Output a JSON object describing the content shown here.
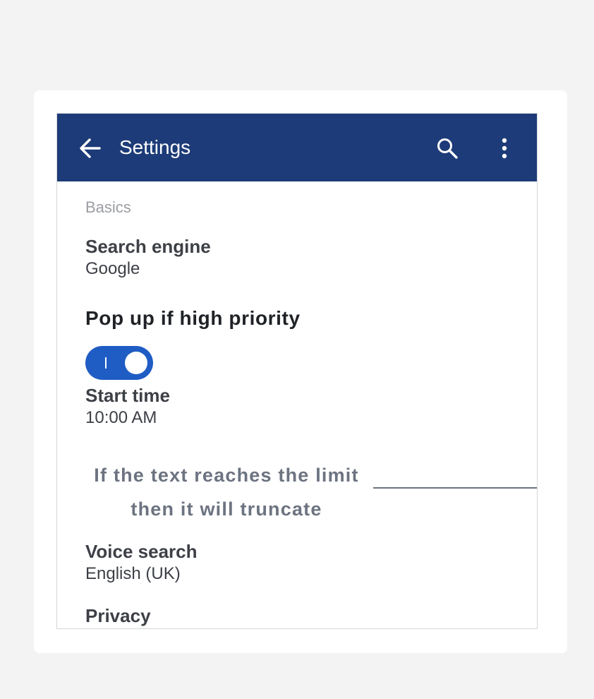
{
  "appbar": {
    "title": "Settings",
    "back_icon": "arrow-back-icon",
    "search_icon": "search-icon",
    "more_icon": "more-vert-icon",
    "color": "#1d3b78"
  },
  "section": {
    "header": "Basics"
  },
  "preferences": {
    "search_engine": {
      "title": "Search engine",
      "summary": "Google"
    },
    "popup": {
      "title": "Pop up if high priority",
      "toggle_on": true,
      "toggle_color": "#1f5cc4"
    },
    "start_time": {
      "title": "Start time",
      "summary": "10:00 AM"
    },
    "truncate": {
      "line1": "If the text reaches the limit",
      "line2": "then it will truncate"
    },
    "voice_search": {
      "title": "Voice search",
      "summary": "English (UK)"
    },
    "privacy": {
      "title": "Privacy"
    }
  }
}
